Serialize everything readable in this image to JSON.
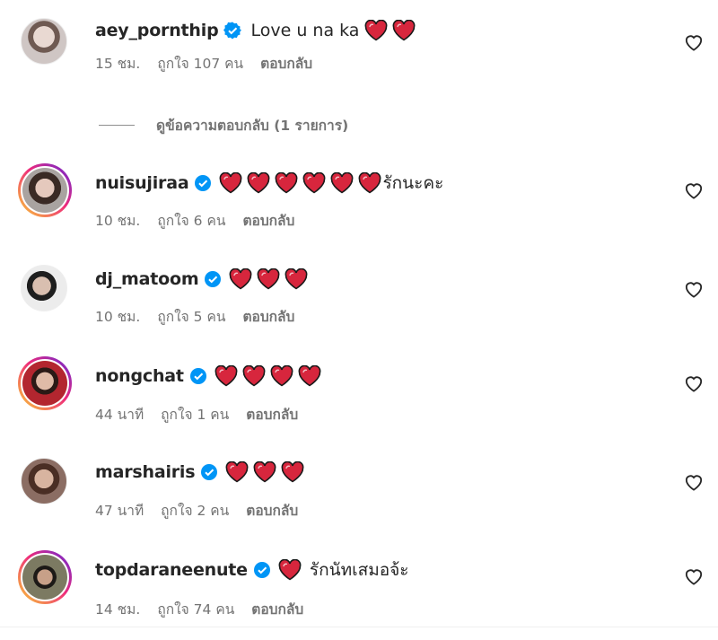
{
  "comments": [
    {
      "username": "aey_pornthip",
      "text": "Love u na ka",
      "hearts_before": 0,
      "hearts_after": 2,
      "time": "15 ชม.",
      "likes": "ถูกใจ 107 คน",
      "reply": "ตอบกลับ",
      "story_ring": false
    },
    {
      "username": "nuisujiraa",
      "text": "รักนะคะ",
      "hearts_before": 6,
      "hearts_after": 0,
      "time": "10 ชม.",
      "likes": "ถูกใจ 6 คน",
      "reply": "ตอบกลับ",
      "story_ring": true
    },
    {
      "username": "dj_matoom",
      "text": "",
      "hearts_before": 3,
      "hearts_after": 0,
      "time": "10 ชม.",
      "likes": "ถูกใจ 5 คน",
      "reply": "ตอบกลับ",
      "story_ring": false
    },
    {
      "username": "nongchat",
      "text": "",
      "hearts_before": 4,
      "hearts_after": 0,
      "time": "44 นาที",
      "likes": "ถูกใจ 1 คน",
      "reply": "ตอบกลับ",
      "story_ring": true
    },
    {
      "username": "marshairis",
      "text": "",
      "hearts_before": 3,
      "hearts_after": 0,
      "time": "47 นาที",
      "likes": "ถูกใจ 2 คน",
      "reply": "ตอบกลับ",
      "story_ring": false
    },
    {
      "username": "topdaraneenute",
      "text": "รักนัทเสมอจ้ะ",
      "hearts_before": 1,
      "hearts_after": 0,
      "time": "14 ชม.",
      "likes": "ถูกใจ 74 คน",
      "reply": "ตอบกลับ",
      "story_ring": true
    }
  ],
  "view_replies": "ดูข้อความตอบกลับ (1 รายการ)",
  "icons": {
    "verified": "verified-badge-icon",
    "heart": "red-heart-emoji",
    "like": "heart-outline-icon"
  },
  "colors": {
    "verified": "#0095f6",
    "heart": "#e0245e",
    "secondary_text": "#737373"
  }
}
